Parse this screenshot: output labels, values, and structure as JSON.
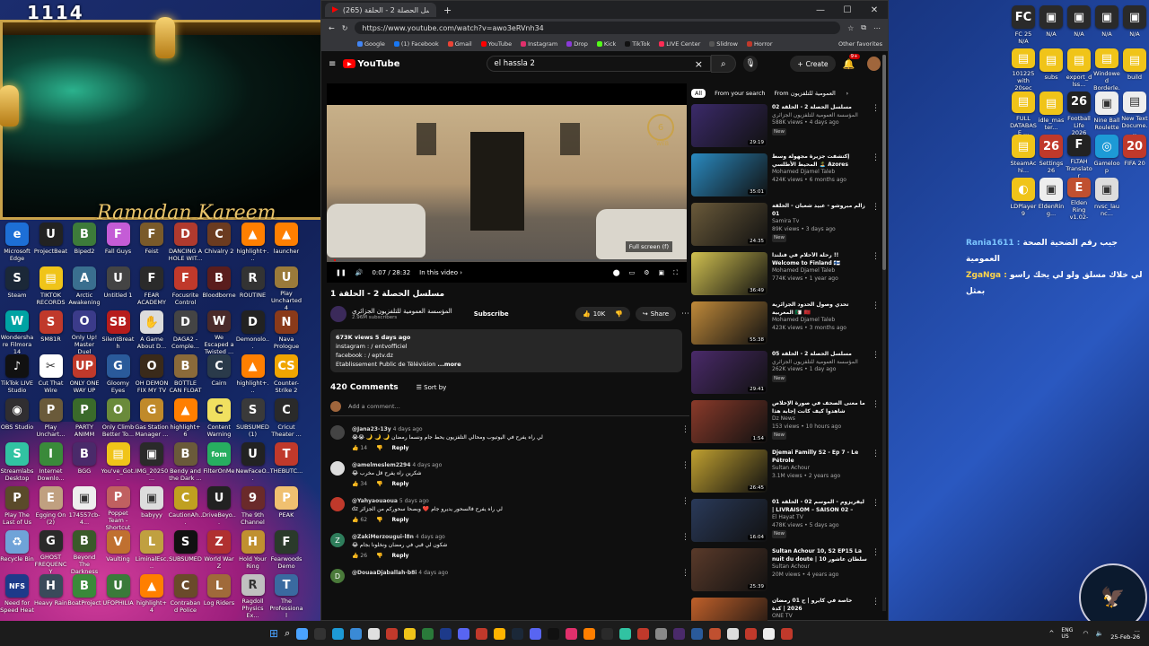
{
  "stream": {
    "name": "1114",
    "banner": "Ramadan Kareem"
  },
  "desktop_left": [
    {
      "label": "Microsoft Edge",
      "color": "#1d6fd6",
      "glyph": "e"
    },
    {
      "label": "ProjectBeat",
      "color": "#222",
      "glyph": "U"
    },
    {
      "label": "Biped2",
      "color": "#3d7b3a",
      "glyph": "B"
    },
    {
      "label": "Fall Guys",
      "color": "#c45cd6",
      "glyph": "F"
    },
    {
      "label": "Feist",
      "color": "#7a5a2a",
      "glyph": "F"
    },
    {
      "label": "DANCING A HOLE WIT...",
      "color": "#b03a2e",
      "glyph": "D"
    },
    {
      "label": "Chivalry 2",
      "color": "#6b3b20",
      "glyph": "C"
    },
    {
      "label": "highlight+...",
      "color": "#ff7f00",
      "glyph": "▲"
    },
    {
      "label": "launcher",
      "color": "#ff7f00",
      "glyph": "▲"
    },
    {
      "label": "Steam",
      "color": "#1b2838",
      "glyph": "S"
    },
    {
      "label": "TIKTOK RECORDS",
      "color": "#f0c419",
      "glyph": "▤"
    },
    {
      "label": "Arctic Awakening",
      "color": "#3a6f8f",
      "glyph": "A"
    },
    {
      "label": "Untitled 1",
      "color": "#444",
      "glyph": "U"
    },
    {
      "label": "FEAR ACADEMY",
      "color": "#2a2a2a",
      "glyph": "F"
    },
    {
      "label": "Focusrite Control",
      "color": "#c0392b",
      "glyph": "F"
    },
    {
      "label": "Bloodborne",
      "color": "#5a1d1d",
      "glyph": "B"
    },
    {
      "label": "ROUTINE",
      "color": "#333",
      "glyph": "R"
    },
    {
      "label": "Play Uncharted 4",
      "color": "#9a7a3a",
      "glyph": "U"
    },
    {
      "label": "Wondershare Filmora 14",
      "color": "#00a3a3",
      "glyph": "W"
    },
    {
      "label": "SM81R",
      "color": "#c0392b",
      "glyph": "S"
    },
    {
      "label": "Only Up! Master Duel",
      "color": "#3b3b8a",
      "glyph": "O"
    },
    {
      "label": "SilentBreath",
      "color": "#b71c1c",
      "glyph": "SB"
    },
    {
      "label": "A Game About D...",
      "color": "#dcdcdc",
      "glyph": "✋"
    },
    {
      "label": "DAGA2 - Comple...",
      "color": "#444",
      "glyph": "D"
    },
    {
      "label": "We Escaped a Twisted ...",
      "color": "#4a2a2a",
      "glyph": "W"
    },
    {
      "label": "Demonolo...",
      "color": "#222",
      "glyph": "D"
    },
    {
      "label": "Nava Prologue",
      "color": "#8a3a1a",
      "glyph": "N"
    },
    {
      "label": "TikTok LIVE Studio",
      "color": "#111",
      "glyph": "♪"
    },
    {
      "label": "Cut That Wire",
      "color": "#fff",
      "glyph": "✂"
    },
    {
      "label": "ONLY ONE WAY UP",
      "color": "#c0392b",
      "glyph": "UP"
    },
    {
      "label": "Gloomy Eyes",
      "color": "#2a5a9a",
      "glyph": "G"
    },
    {
      "label": "OH DEMON FIX MY TV",
      "color": "#3a2a1a",
      "glyph": "O"
    },
    {
      "label": "BOTTLE CAN FLOAT",
      "color": "#8a6a3a",
      "glyph": "B"
    },
    {
      "label": "Cairn",
      "color": "#2a3a4a",
      "glyph": "C"
    },
    {
      "label": "highlight+...",
      "color": "#ff7f00",
      "glyph": "▲"
    },
    {
      "label": "Counter-Strike 2",
      "color": "#f0a500",
      "glyph": "CS"
    },
    {
      "label": "OBS Studio",
      "color": "#302e31",
      "glyph": "◉"
    },
    {
      "label": "Play Unchart...",
      "color": "#6a5a3a",
      "glyph": "P"
    },
    {
      "label": "PARTY ANIMM",
      "color": "#3a6a2a",
      "glyph": "P"
    },
    {
      "label": "Only Climb Better To...",
      "color": "#6a8a3a",
      "glyph": "O"
    },
    {
      "label": "Gas Station Manager ...",
      "color": "#c08a2a",
      "glyph": "G"
    },
    {
      "label": "highlight+6",
      "color": "#ff7f00",
      "glyph": "▲"
    },
    {
      "label": "Content Warning",
      "color": "#f0e060",
      "glyph": "C"
    },
    {
      "label": "SUBSUMED (1)",
      "color": "#3a3a3a",
      "glyph": "S"
    },
    {
      "label": "Cricut Theater ...",
      "color": "#2a2a2a",
      "glyph": "C"
    },
    {
      "label": "Streamlabs Desktop",
      "color": "#31c3a2",
      "glyph": "S"
    },
    {
      "label": "Internet Downlo...",
      "color": "#3a8a3a",
      "glyph": "I"
    },
    {
      "label": "BGG",
      "color": "#4a2a6a",
      "glyph": "B"
    },
    {
      "label": "You've_Got...",
      "color": "#f0c419",
      "glyph": "▤"
    },
    {
      "label": "IMG_20250...",
      "color": "#2a2a2a",
      "glyph": "▣"
    },
    {
      "label": "Bendy and the Dark ...",
      "color": "#6a5a3a",
      "glyph": "B"
    },
    {
      "label": "FilterOnMe",
      "color": "#27ae60",
      "glyph": "fom"
    },
    {
      "label": "NewFaceO...",
      "color": "#222",
      "glyph": "U"
    },
    {
      "label": "THEBUTC...",
      "color": "#c0392b",
      "glyph": "T"
    },
    {
      "label": "Play The Last of Us",
      "color": "#5a4a2a",
      "glyph": "P"
    },
    {
      "label": "Egging On (2)",
      "color": "#c0a080",
      "glyph": "E"
    },
    {
      "label": "174557cb-4...",
      "color": "#eee",
      "glyph": "▣"
    },
    {
      "label": "Poppet Team - Shortcut",
      "color": "#c06060",
      "glyph": "P"
    },
    {
      "label": "babyyy",
      "color": "#ddd",
      "glyph": "▣"
    },
    {
      "label": "CautionAh...",
      "color": "#c0a020",
      "glyph": "C"
    },
    {
      "label": "DriveBeyo...",
      "color": "#222",
      "glyph": "U"
    },
    {
      "label": "The 9th Channel",
      "color": "#6a2a2a",
      "glyph": "9"
    },
    {
      "label": "PEAK",
      "color": "#f0c070",
      "glyph": "P"
    },
    {
      "label": "Recycle Bin",
      "color": "#6fa3d8",
      "glyph": "♻"
    },
    {
      "label": "GHOST FREQUENCY",
      "color": "#2a2a2a",
      "glyph": "G"
    },
    {
      "label": "Beyond The Darkness",
      "color": "#3a5a2a",
      "glyph": "B"
    },
    {
      "label": "Vaulting",
      "color": "#c07030",
      "glyph": "V"
    },
    {
      "label": "LiminalEsc...",
      "color": "#c0a040",
      "glyph": "L"
    },
    {
      "label": "SUBSUMED",
      "color": "#111",
      "glyph": "S"
    },
    {
      "label": "World War Z",
      "color": "#b03030",
      "glyph": "Z"
    },
    {
      "label": "Hold Your Ring",
      "color": "#c09030",
      "glyph": "H"
    },
    {
      "label": "Fearwoods Demo",
      "color": "#2a3a2a",
      "glyph": "F"
    },
    {
      "label": "Need for Speed Heat",
      "color": "#1d3a8a",
      "glyph": "NFS"
    },
    {
      "label": "Heavy Rain",
      "color": "#3a4a5a",
      "glyph": "H"
    },
    {
      "label": "BoatProject",
      "color": "#3a8a3a",
      "glyph": "B"
    },
    {
      "label": "UFOPHILIA",
      "color": "#3a7a3a",
      "glyph": "U"
    },
    {
      "label": "highlight+4",
      "color": "#ff7f00",
      "glyph": "▲"
    },
    {
      "label": "Contraband Police",
      "color": "#6a4a2a",
      "glyph": "C"
    },
    {
      "label": "Log Riders",
      "color": "#a06a3a",
      "glyph": "L"
    },
    {
      "label": "Ragdoll Physics Ex...",
      "color": "#c0c0c0",
      "glyph": "R"
    },
    {
      "label": "The Professional",
      "color": "#3a6aa0",
      "glyph": "T"
    }
  ],
  "desktop_right": [
    {
      "label": "FC 25 N/A",
      "color": "#2a2a2a",
      "glyph": "FC"
    },
    {
      "label": "N/A",
      "color": "#2a2a2a",
      "glyph": "▣"
    },
    {
      "label": "N/A",
      "color": "#2a2a2a",
      "glyph": "▣"
    },
    {
      "label": "N/A",
      "color": "#2a2a2a",
      "glyph": "▣"
    },
    {
      "label": "N/A",
      "color": "#2a2a2a",
      "glyph": "▣"
    },
    {
      "label": "101225 with 20sec delay",
      "color": "#f0c419",
      "glyph": "▤"
    },
    {
      "label": "subs",
      "color": "#f0c419",
      "glyph": "▤"
    },
    {
      "label": "export_dlss...",
      "color": "#f0c419",
      "glyph": "▤"
    },
    {
      "label": "Windowed Borderle...",
      "color": "#f0c419",
      "glyph": "▤"
    },
    {
      "label": "build",
      "color": "#f0c419",
      "glyph": "▤"
    },
    {
      "label": "FULL DATABASE ...",
      "color": "#f0c419",
      "glyph": "▤"
    },
    {
      "label": "idle_master...",
      "color": "#f0c419",
      "glyph": "▤"
    },
    {
      "label": "Football Life 2026",
      "color": "#222",
      "glyph": "26"
    },
    {
      "label": "Nine Ball Roulette",
      "color": "#eee",
      "glyph": "▣"
    },
    {
      "label": "New Text Docume...",
      "color": "#eee",
      "glyph": "▤"
    },
    {
      "label": "SteamAchi...",
      "color": "#f0c419",
      "glyph": "▤"
    },
    {
      "label": "Settings 26",
      "color": "#c0392b",
      "glyph": "26"
    },
    {
      "label": "FLTAH Translator",
      "color": "#222",
      "glyph": "F"
    },
    {
      "label": "Gameloop",
      "color": "#1d9ad6",
      "glyph": "◎"
    },
    {
      "label": "FIFA 20",
      "color": "#c0392b",
      "glyph": "20"
    },
    {
      "label": "LDPlayer 9",
      "color": "#f0c419",
      "glyph": "◐"
    },
    {
      "label": "EldenRing...",
      "color": "#eee",
      "glyph": "▣"
    },
    {
      "label": "Elden Ring v1.02-v1...",
      "color": "#c05030",
      "glyph": "E"
    },
    {
      "label": "nvsc_launc...",
      "color": "#ddd",
      "glyph": "▣"
    }
  ],
  "browser": {
    "tab_title": "(265) مسلسل الحصلة 2 - الحلقة ...",
    "new_tab": "+",
    "minimize": "—",
    "maximize": "☐",
    "close": "✕",
    "url": "https://www.youtube.com/watch?v=awo3eRVnh34",
    "bookmarks": [
      {
        "label": "Google",
        "color": "#4285f4"
      },
      {
        "label": "(1) Facebook",
        "color": "#1877f2"
      },
      {
        "label": "Gmail",
        "color": "#ea4335"
      },
      {
        "label": "YouTube",
        "color": "#ff0000"
      },
      {
        "label": "Instagram",
        "color": "#e1306c"
      },
      {
        "label": "Drop",
        "color": "#8a3ad8"
      },
      {
        "label": "Kick",
        "color": "#53fc18"
      },
      {
        "label": "TikTok",
        "color": "#111"
      },
      {
        "label": "LIVE Center",
        "color": "#fe2c55"
      },
      {
        "label": "Slidrow",
        "color": "#555"
      },
      {
        "label": "Horror",
        "color": "#c0392b"
      }
    ],
    "other_favorites": "Other favorites"
  },
  "youtube": {
    "logo": "YouTube",
    "search_value": "el hassla 2",
    "create": "Create",
    "notif_count": "9+",
    "player": {
      "watermark": "WEB",
      "fullscreen_tip": "Full screen (f)",
      "time": "0:07 / 28:32",
      "in_this_video": "In this video",
      "progress_fraction": 0.004
    },
    "video_title": "مسلسل الحصلة 2 - الحلقة 1",
    "channel_name": "المؤسسة العمومية للتلفزيون الجزائري",
    "subscribers": "2.96M subscribers",
    "subscribe": "Subscribe",
    "likes": "10K",
    "share": "Share",
    "description": {
      "stats": "673K views  5 days ago",
      "line1": "instagram : / entvofficiel",
      "line2": "facebook : / eptv.dz",
      "line3": "Etablissement Public de Télévision",
      "more": "...more"
    },
    "comments_count": "420 Comments",
    "sort_by": "Sort by",
    "add_comment": "Add a comment...",
    "comments": [
      {
        "author": "@Jana23-13y",
        "time": "4 days ago",
        "text": "لي راه يفرح في اليوتيوب ومحالي التلفزيون يحط جام ونسما رمضان 🌙 🌙 🌙 😭😭",
        "likes": "14",
        "reply": "Reply",
        "avatar": "#444",
        "glyph": ""
      },
      {
        "author": "@amelmeslem2294",
        "time": "4 days ago",
        "text": "شكرين راه يفرح قل مخرب 😂",
        "likes": "34",
        "reply": "Reply",
        "avatar": "#ddd",
        "glyph": ""
      },
      {
        "author": "@Yahyaouaoua",
        "time": "5 days ago",
        "text": "لي راه يفرح فالسحور يديرو جام ❤️ وبصحا سحوركم من الجزائر dz",
        "likes": "62",
        "reply": "Reply",
        "avatar": "#c0392b",
        "glyph": ""
      },
      {
        "author": "@ZakiMerzougui-l8n",
        "time": "4 days ago",
        "text": "شكون لي قبي في رمضان ونخلونا بجام 😂",
        "likes": "26",
        "reply": "Reply",
        "avatar": "#2e7d5b",
        "glyph": "Z"
      },
      {
        "author": "@DouaaDjaballah-b8i",
        "time": "4 days ago",
        "text": "",
        "likes": "",
        "reply": "",
        "avatar": "#4a7a3a",
        "glyph": "D"
      }
    ],
    "chips": {
      "all": "All",
      "from_search": "From your search",
      "from_channel": "From المؤسسة العمومية للتلفزيون"
    },
    "recommendations": [
      {
        "title": "مسلسل الحصلة 2 - الحلقة 02",
        "channel": "المؤسسة العمومية للتلفزيون الجزائري",
        "stats": "588K views • 4 days ago",
        "duration": "29:19",
        "badge": "New",
        "thumb": "#3b2a6a"
      },
      {
        "title": "إكتشفت جزيرة مجهولة وسط المحيط الأطلسي 🏝️ Azores Islands !!",
        "channel": "Mohamed Djamel Taleb",
        "stats": "424K views • 6 months ago",
        "duration": "35:01",
        "badge": "",
        "thumb": "#2a8ac0"
      },
      {
        "title": "زالم مبروشو - عبيد شعبان - الحلقة 01",
        "channel": "Samira Tv",
        "stats": "89K views • 3 days ago",
        "duration": "24:35",
        "badge": "New",
        "thumb": "#6a5a3a"
      },
      {
        "title": "رحلة الأحلام في فنلندا !! Welcome to Finland 🇫🇮",
        "channel": "Mohamed Djamel Taleb",
        "stats": "774K views • 1 year ago",
        "duration": "36:49",
        "badge": "",
        "thumb": "#d0c050"
      },
      {
        "title": "تحدي وصول الحدود الجزائرية المغربية 🇩🇿 🇲🇦",
        "channel": "Mohamed Djamel Taleb",
        "stats": "423K views • 3 months ago",
        "duration": "55:38",
        "badge": "",
        "thumb": "#c08a3a"
      },
      {
        "title": "مسلسل الحصلة 2 - الحلقة 05",
        "channel": "المؤسسة العمومية للتلفزيون الجزائري",
        "stats": "262K views • 1 day ago",
        "duration": "29:41",
        "badge": "New",
        "thumb": "#4a2a6a"
      },
      {
        "title": "ما معنى الصحف في صورة الإخلاص شاهدوا كيف كانت إجابة هذا المواطن في حلقة اليوم",
        "channel": "Dz News",
        "stats": "153 views • 10 hours ago",
        "duration": "1:54",
        "badge": "New",
        "thumb": "#8a3a2a"
      },
      {
        "title": "Djemai Familly S2 - Ep 7 - Le Pétrole",
        "channel": "Sultan Achour",
        "stats": "3.1M views • 2 years ago",
        "duration": "26:45",
        "badge": "",
        "thumb": "#c0a030"
      },
      {
        "title": "ليفريزوم - الموسم 02 - الحلقة 01 | LIVRAISOM – SAISON 02 –",
        "channel": "El Hayat TV",
        "stats": "478K views • 5 days ago",
        "duration": "16:04",
        "badge": "New",
        "thumb": "#2a3a5a"
      },
      {
        "title": "Sultan Achour 10, S2 EP15 La nuit du doute | سلطان عاشور 10 -",
        "channel": "Sultan Achour",
        "stats": "20M views • 4 years ago",
        "duration": "25:39",
        "badge": "",
        "thumb": "#5a3a2a"
      },
      {
        "title": "خاصة في كايرو | ح 01 رمضان 2026 | كدة",
        "channel": "ONE TV",
        "stats": "1.3M views • 5 days ago",
        "duration": "26:17",
        "badge": "New",
        "thumb": "#c0602a"
      }
    ]
  },
  "chat": [
    {
      "user": "Rania1611",
      "message": "جيب رقم الضحية الصحة العمومية"
    },
    {
      "user": "ZgaNga",
      "message": "لي خلاك مسلق ولو لي يحك راسو بمثل"
    }
  ],
  "taskbar": {
    "lang": "ENG US",
    "time": "...",
    "date": "25-Feb-26",
    "icons": [
      "#4aa3ff",
      "#333",
      "#1d9ad6",
      "#3a8ad6",
      "#e0e0e0",
      "#c0392b",
      "#f0c419",
      "#2a7a3a",
      "#1d3a8a",
      "#5865f2",
      "#c0392b",
      "#ffb400",
      "#1b2838",
      "#5865f2",
      "#111",
      "#e1306c",
      "#ff7f00",
      "#2a2a2a",
      "#31c3a2",
      "#c0392b",
      "#888",
      "#4a2a6a",
      "#2a5a9a",
      "#c05030",
      "#ddd",
      "#c0392b",
      "#eee",
      "#c0392b"
    ]
  }
}
